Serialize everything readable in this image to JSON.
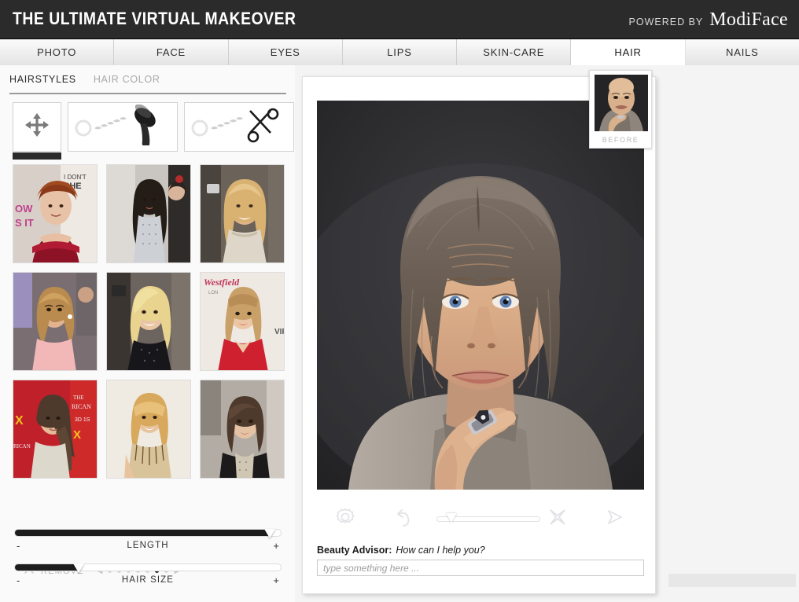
{
  "header": {
    "title": "THE ULTIMATE VIRTUAL MAKEOVER",
    "powered_by_label": "POWERED BY",
    "brand": "ModiFace",
    "bg_color": "#2b2b2b"
  },
  "tabs": [
    {
      "label": "PHOTO",
      "active": false
    },
    {
      "label": "FACE",
      "active": false
    },
    {
      "label": "EYES",
      "active": false
    },
    {
      "label": "LIPS",
      "active": false
    },
    {
      "label": "SKIN-CARE",
      "active": false
    },
    {
      "label": "HAIR",
      "active": true
    },
    {
      "label": "NAILS",
      "active": false
    }
  ],
  "sidebar": {
    "subtabs": [
      {
        "label": "HAIRSTYLES",
        "active": true
      },
      {
        "label": "HAIR COLOR",
        "active": false
      }
    ],
    "tools": [
      {
        "name": "move-tool",
        "icon": "four-arrows-icon",
        "active": true
      },
      {
        "name": "brush-tool",
        "icon": "hairbrush-icon",
        "active": false
      },
      {
        "name": "scissors-tool",
        "icon": "scissors-icon",
        "active": false
      }
    ],
    "thumbnails": [
      {
        "id": 1,
        "alt": "redhead-updo-hairstyle"
      },
      {
        "id": 2,
        "alt": "long-dark-wavy-hairstyle"
      },
      {
        "id": 3,
        "alt": "blonde-medium-layered-hairstyle"
      },
      {
        "id": 4,
        "alt": "golden-brown-wavy-hairstyle"
      },
      {
        "id": 5,
        "alt": "blonde-side-swept-bangs-hairstyle"
      },
      {
        "id": 6,
        "alt": "long-blonde-blunt-bangs-hairstyle"
      },
      {
        "id": 7,
        "alt": "brunette-long-side-hairstyle"
      },
      {
        "id": 8,
        "alt": "blonde-shaggy-bangs-hairstyle"
      },
      {
        "id": 9,
        "alt": "brown-bob-hairstyle"
      }
    ],
    "remove": {
      "label": "REMOVE",
      "icon": "x-cross-icon"
    },
    "pagination": {
      "prev_icon": "triangle-left-icon",
      "next_icon": "triangle-right-icon",
      "total_pages": 7,
      "current_page": 6
    },
    "sliders": [
      {
        "name": "LENGTH",
        "value": 96,
        "minus": "-",
        "plus": "+"
      },
      {
        "name": "HAIR SIZE",
        "value": 24,
        "minus": "-",
        "plus": "+"
      }
    ]
  },
  "right_panel": {
    "before_card": {
      "label": "BEFORE",
      "alt": "before-photo-bald-man"
    },
    "main_photo": {
      "alt": "after-photo-man-with-long-hairstyle",
      "bg_color": "#2b2b2e"
    },
    "toolbar": [
      {
        "name": "settings-gear",
        "icon": "gear-icon"
      },
      {
        "name": "undo",
        "icon": "undo-arrow-icon"
      },
      {
        "name": "opacity-slider",
        "icon": "slider-icon",
        "value": 17
      },
      {
        "name": "clear",
        "icon": "x-cross-icon"
      },
      {
        "name": "play",
        "icon": "play-triangle-icon"
      }
    ],
    "advisor": {
      "label": "Beauty Advisor:",
      "question": "How can I help you?",
      "input_value": "",
      "input_placeholder": "type something here ..."
    }
  }
}
